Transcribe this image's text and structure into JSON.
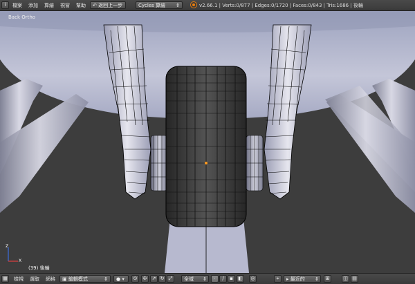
{
  "topbar": {
    "menus": [
      "檔案",
      "添加",
      "算繪",
      "視窗",
      "幫助"
    ],
    "undo_button": "返回上一步",
    "render_engine": "Cycles 算繪",
    "stats": "v2.66.1 | Verts:0/877 | Edges:0/1720 | Faces:0/843 | Tris:1686 | 後輪"
  },
  "viewport": {
    "view_label": "Back Ortho",
    "object_label": "(39) 後輪"
  },
  "bottombar": {
    "menus": [
      "檢視",
      "選取",
      "網格"
    ],
    "mode": "編輯模式",
    "pivot": "全域",
    "snap": "最近的"
  },
  "colors": {
    "background": "#3c3c3c",
    "mesh": "#b4b4c8",
    "wire": "#000000",
    "tire": "#3a3a3a"
  }
}
